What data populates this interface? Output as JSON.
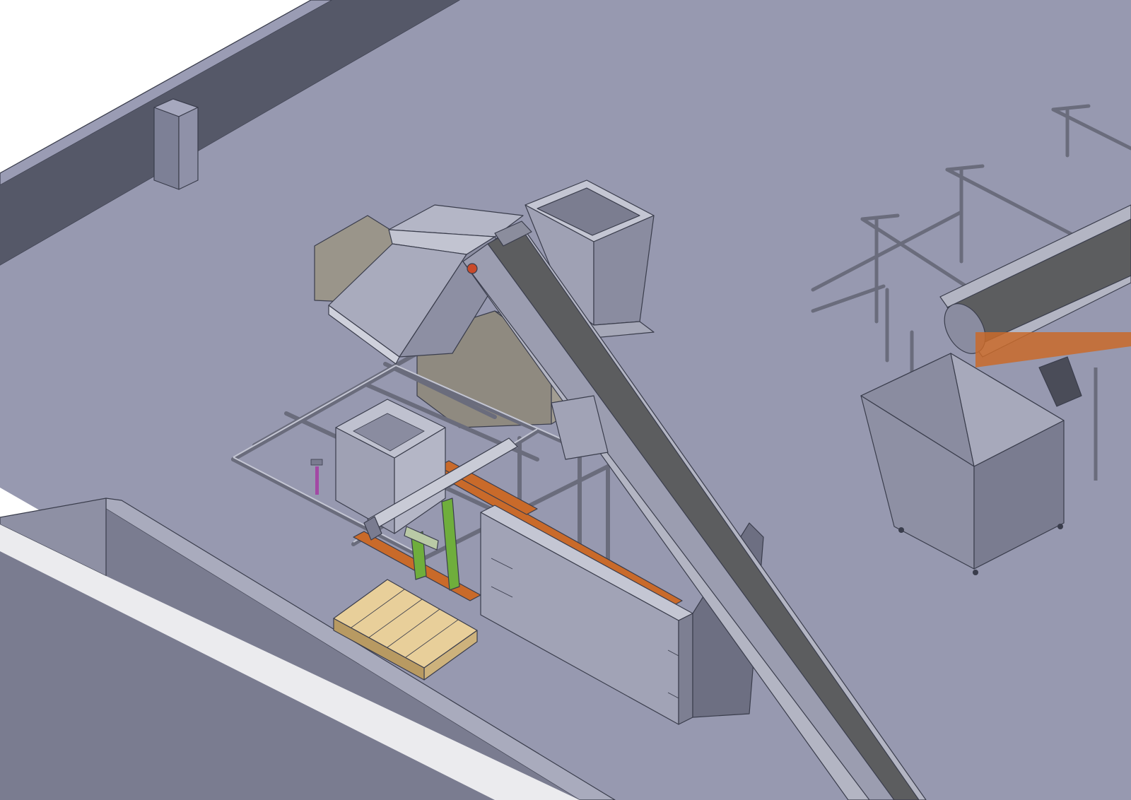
{
  "scene": {
    "view": "isometric-3d-cad-model",
    "background_color": "#ffffff",
    "floor_color": "#9799b0",
    "wall_top_color": "#9a9cb4",
    "wall_side_color": "#5a5d6e",
    "metal_color": "#a3a5b5",
    "dark_metal_color": "#6a6c7c",
    "belt_color": "#5c5d5f",
    "beam_orange_color": "#c96a2a",
    "pallet_color": "#e8cf9a",
    "box_color": "#9a958a",
    "green_part_color": "#6fae3c",
    "purple_part_color": "#a349a4"
  },
  "components": [
    {
      "id": "floor-slab",
      "label": ""
    },
    {
      "id": "back-wall",
      "label": ""
    },
    {
      "id": "front-wall",
      "label": ""
    },
    {
      "id": "inclined-belt-conveyor",
      "label": ""
    },
    {
      "id": "feed-hopper",
      "label": ""
    },
    {
      "id": "hood-cover",
      "label": ""
    },
    {
      "id": "packaging-frame",
      "label": ""
    },
    {
      "id": "small-hopper",
      "label": ""
    },
    {
      "id": "side-panel",
      "label": ""
    },
    {
      "id": "wooden-pallet",
      "label": ""
    },
    {
      "id": "right-collection-bin",
      "label": ""
    },
    {
      "id": "right-flat-conveyor",
      "label": ""
    },
    {
      "id": "right-platform-railing",
      "label": ""
    }
  ]
}
